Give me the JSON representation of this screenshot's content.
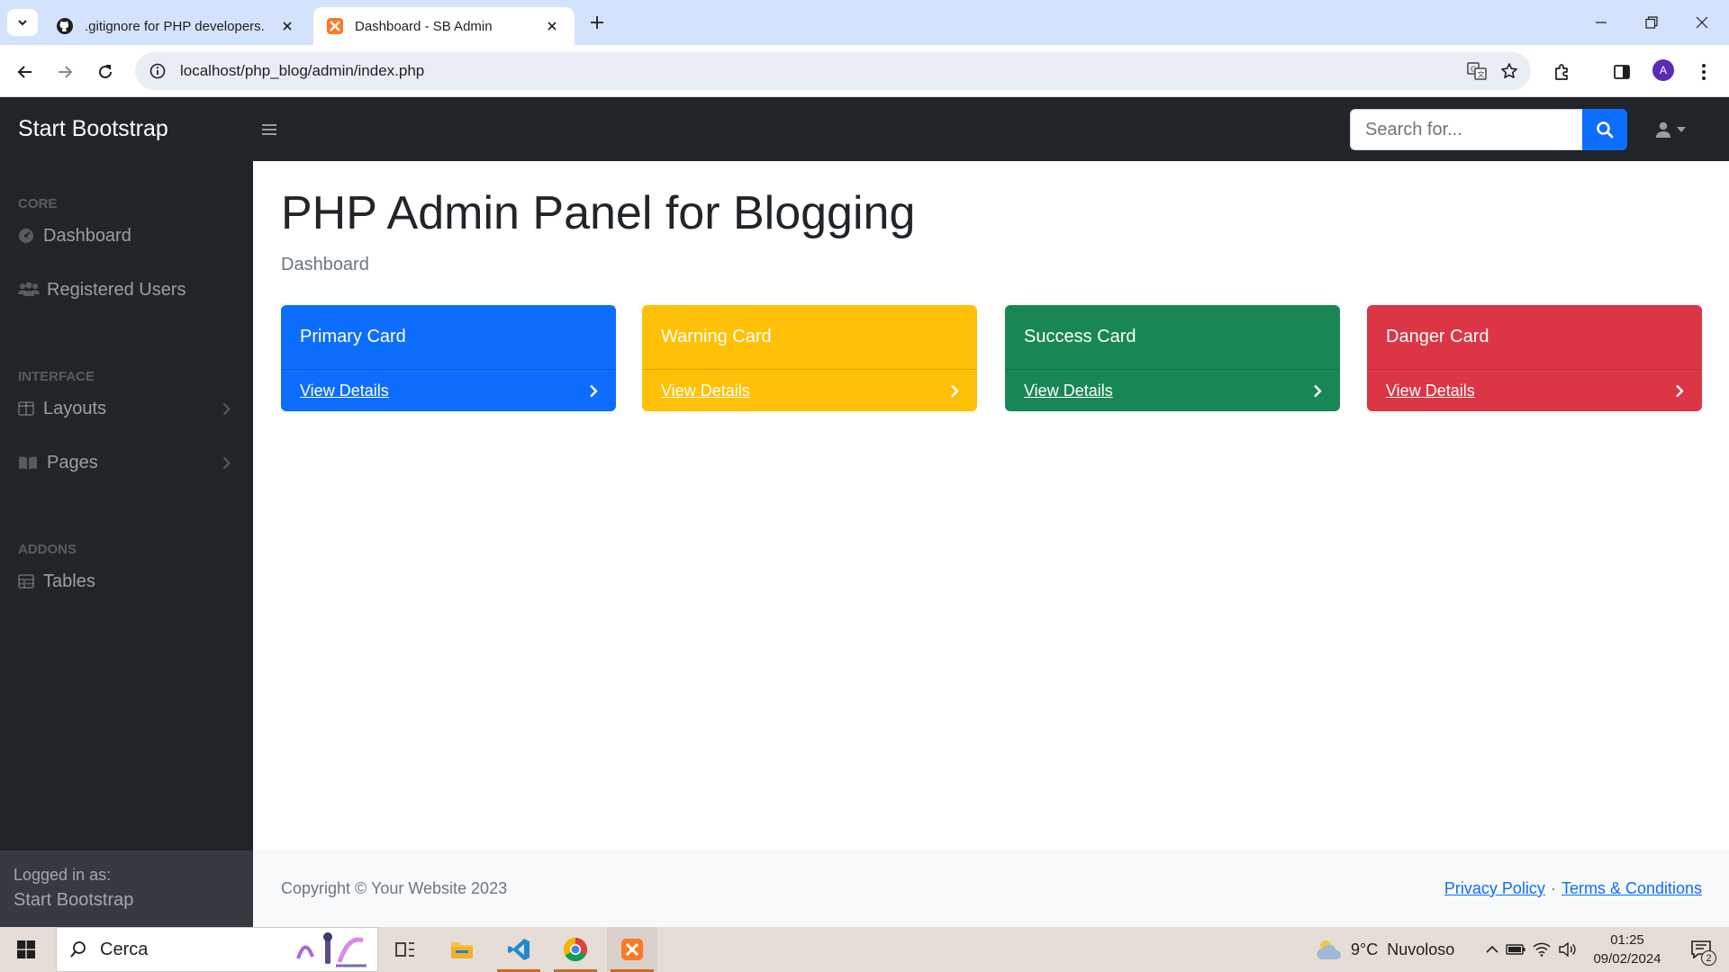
{
  "browser": {
    "tabs": [
      {
        "title": ".gitignore for PHP developers.",
        "icon": "github-icon",
        "active": false
      },
      {
        "title": "Dashboard - SB Admin",
        "icon": "xampp-icon",
        "active": true
      }
    ],
    "url": "localhost/php_blog/admin/index.php",
    "profile_initial": "A"
  },
  "topnav": {
    "brand": "Start Bootstrap",
    "search_placeholder": "Search for..."
  },
  "sidebar": {
    "sections": [
      {
        "heading": "CORE",
        "items": [
          {
            "label": "Dashboard",
            "icon": "tachometer-icon"
          },
          {
            "label": "Registered Users",
            "icon": "users-icon"
          }
        ]
      },
      {
        "heading": "INTERFACE",
        "items": [
          {
            "label": "Layouts",
            "icon": "columns-icon",
            "has_submenu": true
          },
          {
            "label": "Pages",
            "icon": "book-open-icon",
            "has_submenu": true
          }
        ]
      },
      {
        "heading": "ADDONS",
        "items": [
          {
            "label": "Tables",
            "icon": "table-icon"
          }
        ]
      }
    ],
    "footer": {
      "label": "Logged in as:",
      "name": "Start Bootstrap"
    }
  },
  "main": {
    "title": "PHP Admin Panel for Blogging",
    "breadcrumb": "Dashboard",
    "cards": [
      {
        "title": "Primary Card",
        "link": "View Details",
        "color": "#0d6efd"
      },
      {
        "title": "Warning Card",
        "link": "View Details",
        "color": "#ffc107"
      },
      {
        "title": "Success Card",
        "link": "View Details",
        "color": "#198754"
      },
      {
        "title": "Danger Card",
        "link": "View Details",
        "color": "#dc3545"
      }
    ],
    "footer": {
      "copyright": "Copyright © Your Website 2023",
      "links": [
        "Privacy Policy",
        "Terms & Conditions"
      ],
      "separator": "·"
    }
  },
  "taskbar": {
    "search_label": "Cerca",
    "weather": {
      "temp": "9°C",
      "condition": "Nuvoloso"
    },
    "time": "01:25",
    "date": "09/02/2024",
    "notification_count": "2"
  }
}
